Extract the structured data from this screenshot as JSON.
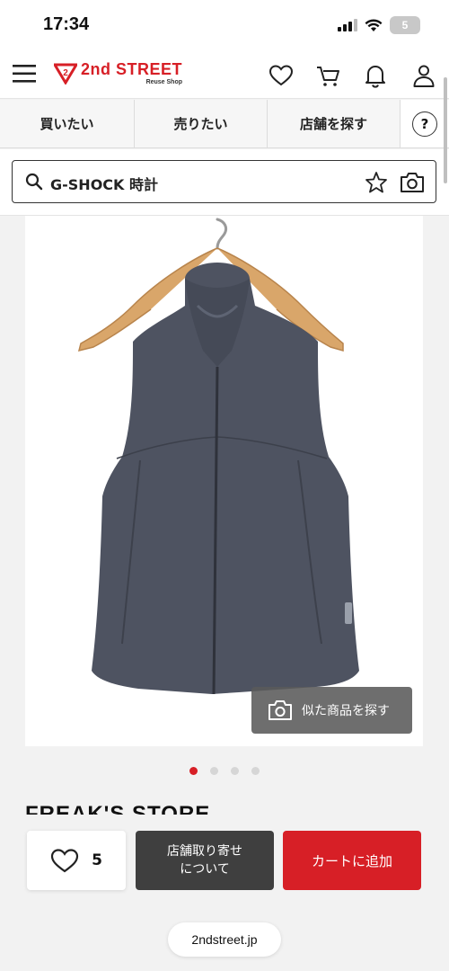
{
  "status_bar": {
    "time": "17:34",
    "battery": "5"
  },
  "header": {
    "logo_main": "2nd STREET",
    "logo_sub": "Reuse Shop",
    "logo_badge": "2",
    "icons": [
      "heart-icon",
      "cart-icon",
      "bell-icon",
      "user-icon"
    ]
  },
  "nav": {
    "tabs": [
      {
        "label": "買いたい"
      },
      {
        "label": "売りたい"
      },
      {
        "label": "店舗を探す"
      }
    ],
    "help": "?"
  },
  "search": {
    "query": "G-SHOCK 時計"
  },
  "product": {
    "similar_button": "似た商品を探す",
    "gallery": {
      "current": 1,
      "total": 4
    },
    "brand": "FREAK'S STORE"
  },
  "actions": {
    "favorite_count": "5",
    "store_button_line1": "店舗取り寄せ",
    "store_button_line2": "について",
    "cart_button": "カートに追加"
  },
  "browser": {
    "url": "2ndstreet.jp"
  },
  "colors": {
    "brand_red": "#d71f26",
    "dark_button": "#3f3f3f"
  }
}
